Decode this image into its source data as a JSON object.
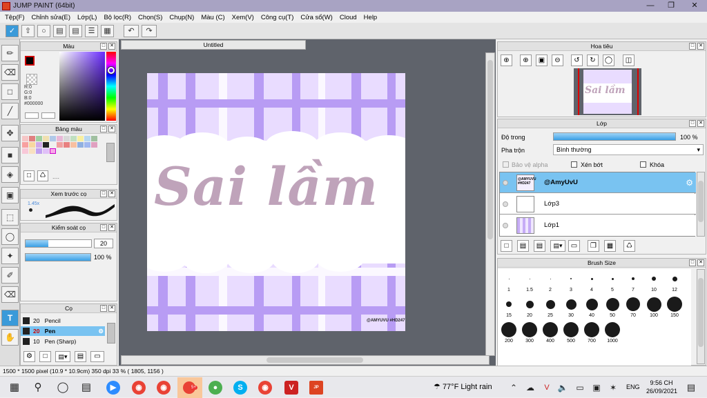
{
  "window": {
    "title": "JUMP PAINT (64bit)"
  },
  "menu": [
    "Tệp(F)",
    "Chỉnh sửa(E)",
    "Lớp(L)",
    "Bộ lọc(R)",
    "Chọn(S)",
    "Chụp(N)",
    "Màu (C)",
    "Xem(V)",
    "Công cụ(T)",
    "Cửa sổ(W)",
    "Cloud",
    "Help"
  ],
  "panels": {
    "color": {
      "title": "Màu",
      "r": "R:0",
      "g": "G:0",
      "b": "B:0",
      "hex": "#000000"
    },
    "palette": {
      "title": "Bảng màu",
      "extra": "...."
    },
    "preview": {
      "title": "Xem trước cọ",
      "size": "1.45x"
    },
    "brush_control": {
      "title": "Kiểm soát cọ",
      "size": "20",
      "opacity": "100 %",
      "opacity_level": 1.0,
      "size_level": 0.35
    },
    "brush": {
      "title": "Cọ",
      "items": [
        {
          "size": "20",
          "name": "Pencil"
        },
        {
          "size": "20",
          "name": "Pen"
        },
        {
          "size": "10",
          "name": "Pen (Sharp)"
        }
      ]
    },
    "navigator": {
      "title": "Hoa tiêu"
    },
    "layer": {
      "title": "Lớp",
      "opacity_label": "Độ trong",
      "opacity_value": "100 %",
      "blend_label": "Pha trộn",
      "blend_value": "Bình thường",
      "protect_alpha": "Bảo vệ alpha",
      "clip": "Xén bớt",
      "lock": "Khóa",
      "layers": [
        {
          "name": "@AmyUvU"
        },
        {
          "name": "Lớp3"
        },
        {
          "name": "Lớp1"
        }
      ]
    },
    "brush_size": {
      "title": "Brush Size",
      "sizes": [
        "1",
        "1.5",
        "2",
        "3",
        "4",
        "5",
        "7",
        "10",
        "12",
        "15",
        "20",
        "25",
        "30",
        "40",
        "50",
        "70",
        "100",
        "150",
        "200",
        "300",
        "400",
        "500",
        "700",
        "1000"
      ]
    }
  },
  "canvas": {
    "tab": "Untitled",
    "text": "Sai lầm",
    "watermark": "@AMYUVU #HD247"
  },
  "status": {
    "text": "1500 * 1500 pixel   (10.9 * 10.9cm)   350 dpi   33 %   ( 1805, 1156 )"
  },
  "taskbar": {
    "weather": "77°F  Light rain",
    "lang": "ENG",
    "time": "9:56 CH",
    "date": "26/09/2021",
    "badge": "5+"
  }
}
